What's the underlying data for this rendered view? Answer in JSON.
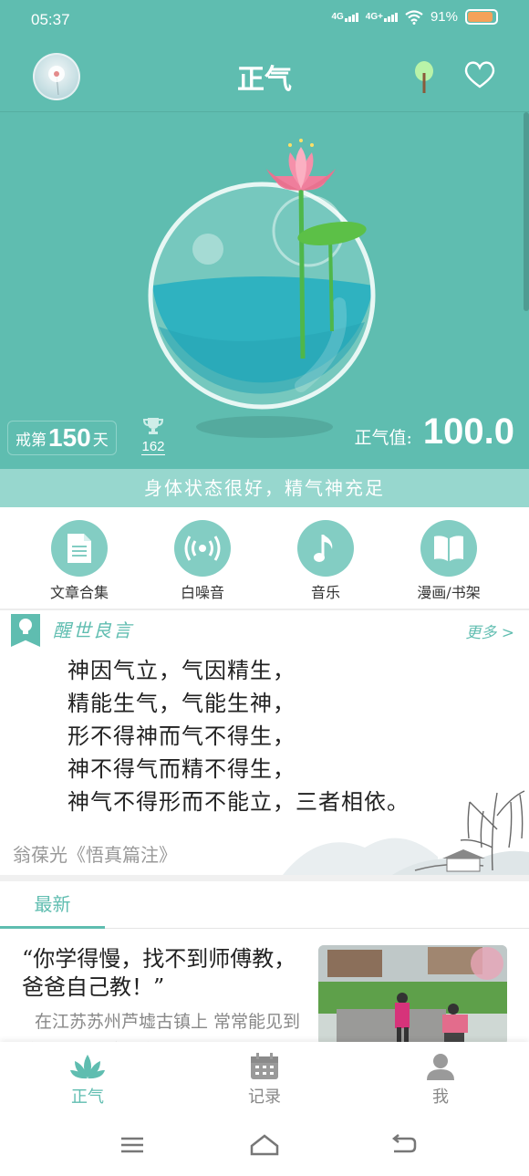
{
  "status_bar": {
    "time": "05:37",
    "signal1": "4G",
    "signal2": "4G+",
    "battery": "91%",
    "battery_level": 0.91
  },
  "header": {
    "title": "正气"
  },
  "hero": {
    "streak_prefix": "戒第",
    "streak_days": "150",
    "streak_suffix": "天",
    "trophy_count": "162",
    "qi_label": "正气值:",
    "qi_value": "100.0"
  },
  "status_message": "身体状态很好，精气神充足",
  "shortcuts": [
    {
      "label": "文章合集",
      "icon": "document-icon"
    },
    {
      "label": "白噪音",
      "icon": "broadcast-icon"
    },
    {
      "label": "音乐",
      "icon": "music-note-icon"
    },
    {
      "label": "漫画/书架",
      "icon": "book-icon"
    }
  ],
  "quote": {
    "title": "醒世良言",
    "more": "更多 >",
    "lines": [
      "神因气立，气因精生，",
      "精能生气，气能生神，",
      "形不得神而气不得生，",
      "神不得气而精不得生，",
      "神气不得形而不能立，三者相依。"
    ],
    "author": "翁葆光《悟真篇注》"
  },
  "tabs": {
    "latest": "最新"
  },
  "article": {
    "title": "“你学得慢，找不到师傅教，爸爸自己教！”",
    "excerpt": "在江苏苏州芦墟古镇上 常常能见到这样一对父女，每Ⅰ"
  },
  "bottom_nav": [
    {
      "label": "正气",
      "icon": "lotus-icon",
      "active": true
    },
    {
      "label": "记录",
      "icon": "calendar-icon",
      "active": false
    },
    {
      "label": "我",
      "icon": "person-icon",
      "active": false
    }
  ],
  "colors": {
    "primary": "#5fbdb0",
    "light": "#97d7ce",
    "text": "#222222",
    "muted": "#888888"
  }
}
